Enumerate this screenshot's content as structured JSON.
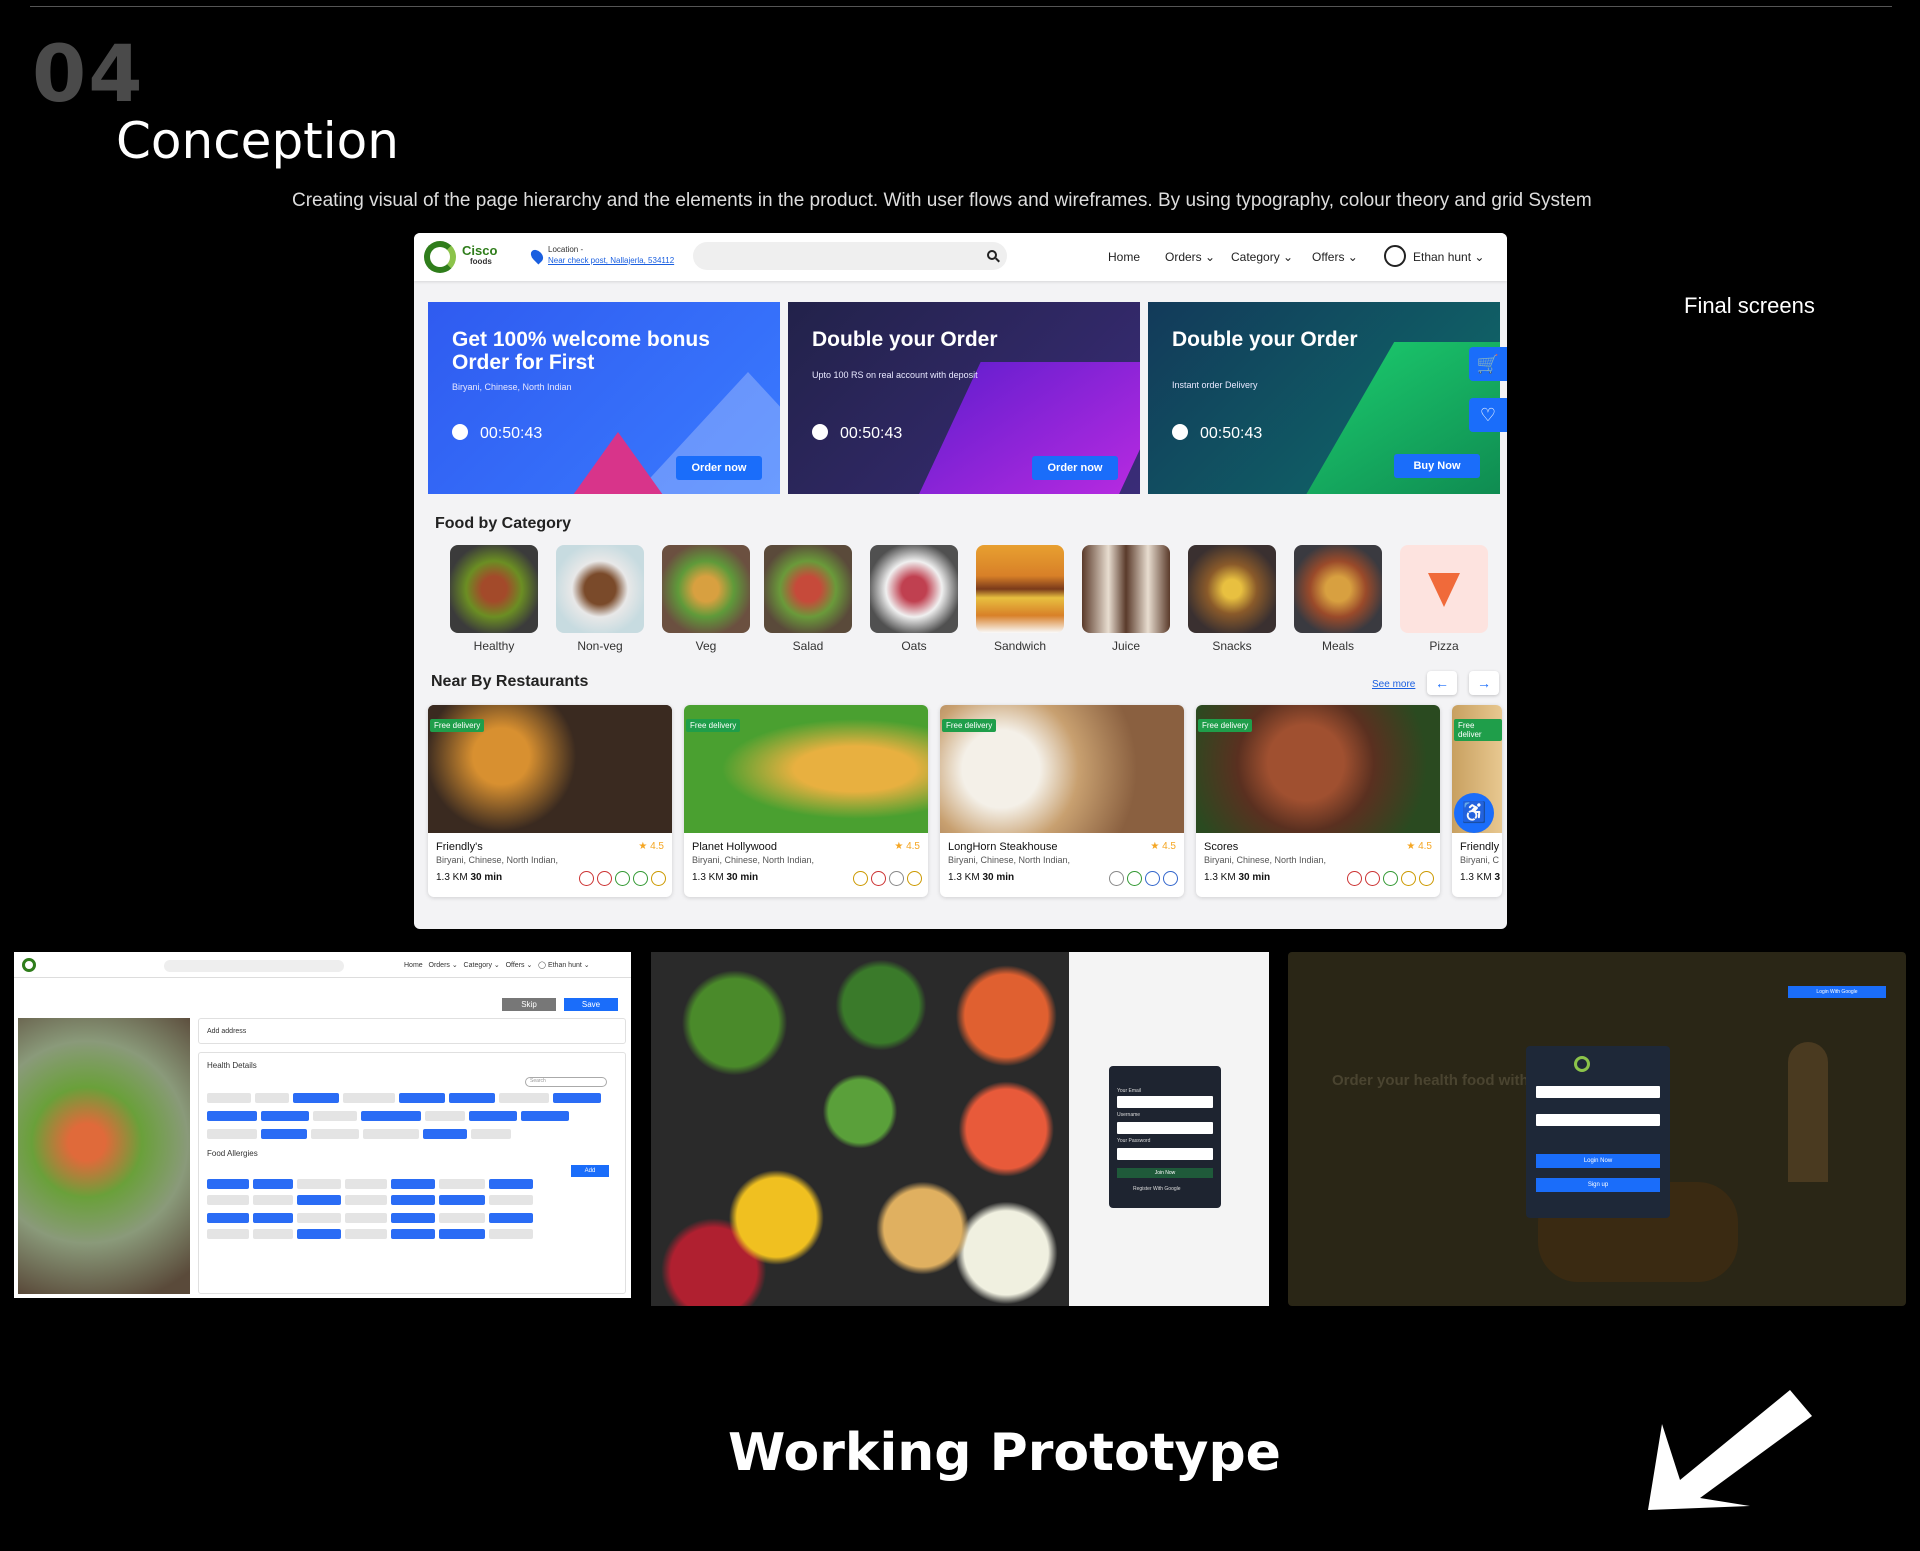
{
  "section": {
    "number": "04",
    "title": "Conception",
    "subtitle": "Creating visual of  the page hierarchy and the elements in the product. With user flows and wireframes. By using typography, colour theory and grid System",
    "final_label": "Final screens",
    "prototype_label": "Working Prototype"
  },
  "app": {
    "logo_name": "Cisco",
    "logo_sub": "foods",
    "location_label": "Location -",
    "location_value": "Near check post, Nallajerla, 534112",
    "nav": [
      "Home",
      "Orders ⌄",
      "Category ⌄",
      "Offers ⌄"
    ],
    "user": "Ethan hunt ⌄",
    "banners": [
      {
        "title": "Get 100% welcome bonus Order for First",
        "sub": "Biryani, Chinese, North Indian",
        "timer": "00:50:43",
        "button": "Order now"
      },
      {
        "title": "Double your Order",
        "sub": "Upto 100 RS on real account with deposit",
        "timer": "00:50:43",
        "button": "Order now"
      },
      {
        "title": "Double your Order",
        "sub": "Instant order Delivery",
        "timer": "00:50:43",
        "button": "Buy Now"
      }
    ],
    "category_title": "Food by Category",
    "categories": [
      "Healthy",
      "Non-veg",
      "Veg",
      "Salad",
      "Oats",
      "Sandwich",
      "Juice",
      "Snacks",
      "Meals",
      "Pizza"
    ],
    "nearby_title": "Near By Restaurants",
    "see_more": "See more",
    "restaurants": [
      {
        "name": "Friendly's",
        "cuisine": "Biryani, Chinese, North Indian,",
        "rating": "★ 4.5",
        "distance": "1.3 KM",
        "time": "30 min",
        "badge": "Free delivery"
      },
      {
        "name": "Planet Hollywood",
        "cuisine": "Biryani, Chinese, North Indian,",
        "rating": "★ 4.5",
        "distance": "1.3 KM",
        "time": "30 min",
        "badge": "Free delivery"
      },
      {
        "name": "LongHorn Steakhouse",
        "cuisine": "Biryani, Chinese, North Indian,",
        "rating": "★ 4.5",
        "distance": "1.3 KM",
        "time": "30 min",
        "badge": "Free delivery"
      },
      {
        "name": "Scores",
        "cuisine": "Biryani, Chinese, North Indian,",
        "rating": "★ 4.5",
        "distance": "1.3 KM",
        "time": "30 min",
        "badge": "Free delivery"
      },
      {
        "name": "Friendly",
        "cuisine": "Biryani, C",
        "rating": "",
        "distance": "1.3 KM",
        "time": "3",
        "badge": "Free deliver"
      }
    ]
  },
  "screen2": {
    "skip": "Skip",
    "save": "Save",
    "add_address": "Add address",
    "health_details": "Health Details",
    "search_placeholder": "Search",
    "food_allergies": "Food Allergies",
    "add": "Add"
  },
  "screen3": {
    "email_label": "Your Email",
    "username_label": "Username",
    "password_label": "Your Password",
    "join": "Join Now",
    "google": "Register With Google"
  },
  "screen4": {
    "headline": "Order your health food with",
    "login_google": "Login With Google",
    "login": "Login Now",
    "signup": "Sign up"
  },
  "colors": {
    "accent": "#1a6dfa",
    "brand": "#2f7d1b"
  }
}
